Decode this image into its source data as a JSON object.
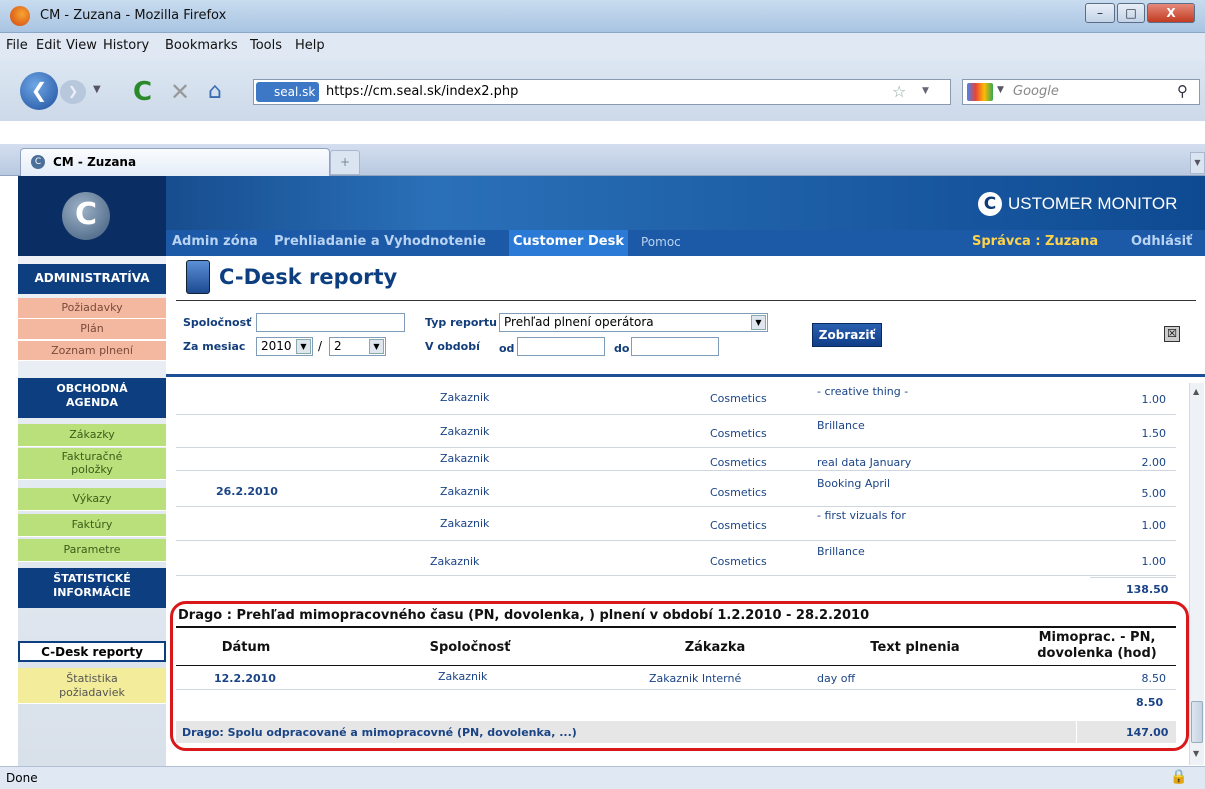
{
  "window": {
    "title": "CM - Zuzana - Mozilla Firefox"
  },
  "menu": [
    "File",
    "Edit",
    "View",
    "History",
    "Bookmarks",
    "Tools",
    "Help"
  ],
  "address": {
    "site_badge": "seal.sk",
    "url": "https://cm.seal.sk/index2.php"
  },
  "search": {
    "placeholder": "Google"
  },
  "tab": {
    "label": "CM - Zuzana"
  },
  "brand": {
    "logo_letter": "C",
    "name": "USTOMER MONITOR"
  },
  "topnav": {
    "items": [
      "Admin zóna",
      "Prehliadanie a Vyhodnotenie",
      "Customer Desk",
      "Pomoc"
    ],
    "user": "Správca : Zuzana",
    "logout": "Odhlásiť"
  },
  "sidebar": {
    "head1": "ADMINISTRATÍVA",
    "admin_items": [
      "Požiadavky",
      "Plán",
      "Zoznam plnení"
    ],
    "head2": "OBCHODNÁ AGENDA",
    "agenda_items": [
      "Zákazky",
      "Fakturačné položky",
      "Výkazy",
      "Faktúry",
      "Parametre"
    ],
    "head3": "ŠTATISTICKÉ INFORMÁCIE",
    "stat_items": [
      "C-Desk reporty",
      "Štatistika požiadaviek"
    ]
  },
  "page": {
    "title": "C-Desk reporty"
  },
  "filters": {
    "company_label": "Spoločnosť",
    "report_label": "Typ reportu",
    "report_value": "Prehľad plnení operátora",
    "month_label": "Za mesiac",
    "year": "2010",
    "sep": "/",
    "month": "2",
    "period_label": "V období",
    "from_label": "od",
    "to_label": "do",
    "show_button": "Zobraziť"
  },
  "rows": [
    {
      "date": "",
      "company": "Zakaznik",
      "order": "Cosmetics",
      "text": "- creative thing -",
      "hours": "1.00"
    },
    {
      "date": "",
      "company": "Zakaznik",
      "order": "Cosmetics",
      "text": "Brillance",
      "hours": "1.50"
    },
    {
      "date": "",
      "company": "Zakaznik",
      "order": "Cosmetics",
      "text": "real data January",
      "hours": "2.00"
    },
    {
      "date": "26.2.2010",
      "company": "Zakaznik",
      "order": "Cosmetics",
      "text": "Booking April",
      "hours": "5.00"
    },
    {
      "date": "",
      "company": "Zakaznik",
      "order": "Cosmetics",
      "text": "- first vizuals for",
      "hours": "1.00"
    },
    {
      "date": "",
      "company": "Zakaznik",
      "order": "Cosmetics",
      "text": "Brillance",
      "hours": "1.00"
    }
  ],
  "subtotal1": "138.50",
  "section2": {
    "title": "Drago : Prehľad mimopracovného času (PN, dovolenka, ) plnení v období  1.2.2010 - 28.2.2010",
    "headers": [
      "Dátum",
      "Spoločnosť",
      "Zákazka",
      "Text plnenia",
      "Mimoprac. - PN, dovolenka (hod)"
    ],
    "row": {
      "date": "12.2.2010",
      "company": "Zakaznik",
      "order": "Zakaznik  Interné",
      "text": "day off",
      "hours": "8.50"
    },
    "subtotal": "8.50",
    "total_label": "Drago: Spolu odpracované a mimopracovné (PN, dovolenka, ...)",
    "total": "147.00"
  },
  "status": "Done",
  "colors": {
    "highlight": "#d8181a",
    "navy": "#0d3f80"
  }
}
